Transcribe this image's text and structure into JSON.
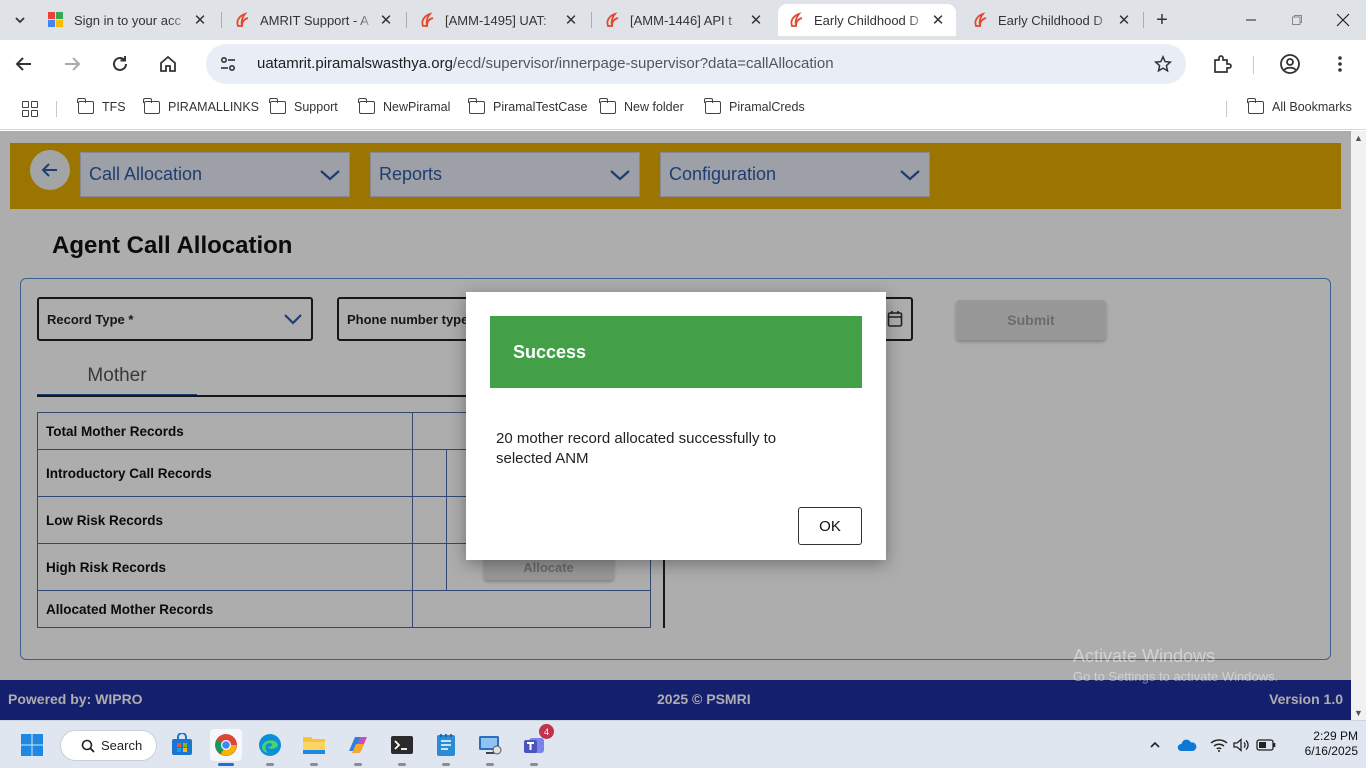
{
  "browser": {
    "tabs": [
      {
        "title": "Sign in to your acc",
        "icon": "google-icon"
      },
      {
        "title": "AMRIT Support - A",
        "icon": "amrit-icon"
      },
      {
        "title": "[AMM-1495] UAT:",
        "icon": "amrit-icon"
      },
      {
        "title": "[AMM-1446] API t",
        "icon": "amrit-icon"
      },
      {
        "title": "Early Childhood D",
        "icon": "amrit-icon",
        "active": true
      },
      {
        "title": "Early Childhood D",
        "icon": "amrit-icon"
      }
    ],
    "url_host": "uatamrit.piramalswasthya.org",
    "url_path": "/ecd/supervisor/innerpage-supervisor?data=callAllocation",
    "bookmarks": [
      "TFS",
      "PIRAMALLINKS",
      "Support",
      "NewPiramal",
      "PiramalTestCase",
      "New folder",
      "PiramalCreds"
    ],
    "all_bookmarks": "All Bookmarks"
  },
  "app": {
    "nav": {
      "call_allocation": "Call Allocation",
      "reports": "Reports",
      "configuration": "Configuration"
    },
    "page_title": "Agent Call Allocation",
    "form": {
      "record_type": "Record Type *",
      "phone_number_type": "Phone number type",
      "submit": "Submit"
    },
    "tab_label": "Mother",
    "table": {
      "rows": [
        "Total Mother Records",
        "Introductory Call Records",
        "Low Risk Records",
        "High Risk Records",
        "Allocated Mother Records"
      ],
      "allocate": "Allocate"
    },
    "watermark": {
      "title": "Activate Windows",
      "subtitle": "Go to Settings to activate Windows."
    },
    "footer": {
      "powered_by": "Powered by: WIPRO",
      "copyright": "2025 © PSMRI",
      "version": "Version 1.0"
    }
  },
  "modal": {
    "title": "Success",
    "message": "20 mother record allocated successfully to selected ANM",
    "ok": "OK"
  },
  "taskbar": {
    "search": "Search",
    "teams_badge": "4",
    "time": "2:29 PM",
    "date": "6/16/2025"
  },
  "colors": {
    "nav_band": "#e6ac00",
    "success": "#43a047",
    "footer": "#1e2ea3",
    "link_blue": "#2e5aa8"
  }
}
